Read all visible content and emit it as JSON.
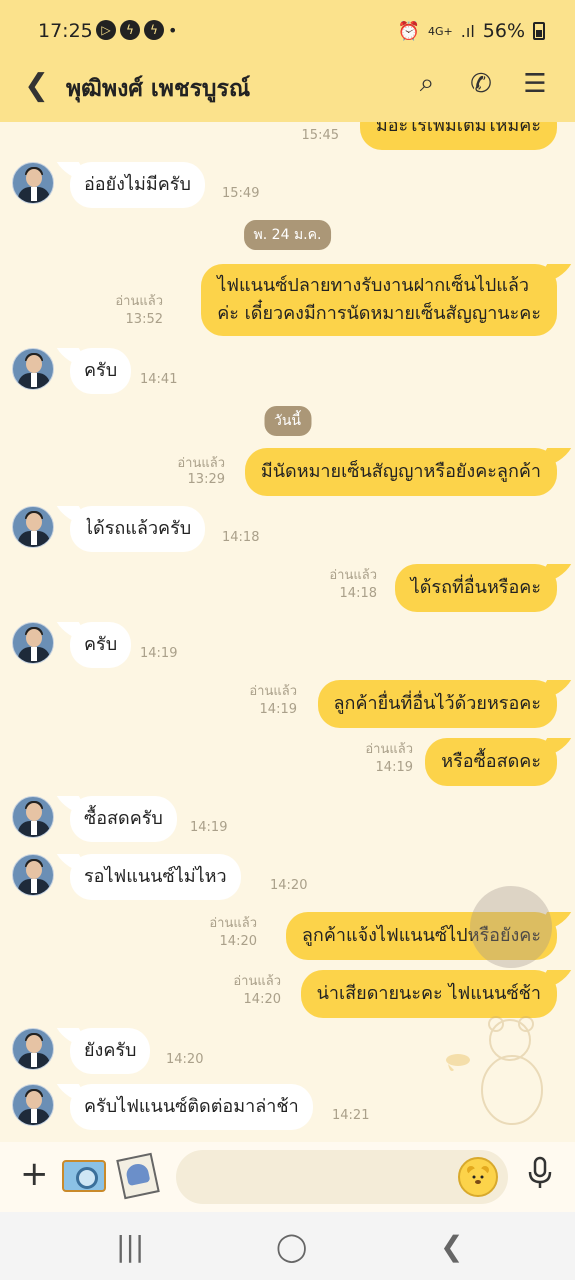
{
  "status_bar": {
    "time": "17:25",
    "network": "4G+",
    "signal": ".ıl",
    "battery": "56%",
    "icons": [
      "whatsapp-icon",
      "messenger-icon",
      "messenger-icon",
      "dot-icon",
      "alarm-icon",
      "battery-icon"
    ]
  },
  "header": {
    "title": "พุฒิพงศ์ เพชรบูรณ์",
    "back_glyph": "❮",
    "search_glyph": "⌕",
    "call_glyph": "✆",
    "menu_glyph": "☰"
  },
  "chat": {
    "top_partial": {
      "text": "มีอะไรเพิ่มเติมไหมคะ",
      "time": "15:45"
    },
    "messages": [
      {
        "dir": "in",
        "text": "อ่อยังไม่มีครับ",
        "time": "15:49"
      },
      {
        "dir": "date",
        "text": "พ. 24 ม.ค."
      },
      {
        "dir": "out",
        "lines": [
          "ไฟแนนซ์ปลายทางรับงานฝากเซ็นไปแล้ว",
          "ค่ะ เดี๋ยวคงมีการนัดหมายเซ็นสัญญานะคะ"
        ],
        "read": "อ่านแล้ว",
        "time": "13:52"
      },
      {
        "dir": "in",
        "text": "ครับ",
        "time": "14:41"
      },
      {
        "dir": "date",
        "text": "วันนี้"
      },
      {
        "dir": "out",
        "text": "มีนัดหมายเซ็นสัญญาหรือยังคะลูกค้า",
        "read": "อ่านแล้ว",
        "time": "13:29"
      },
      {
        "dir": "in",
        "text": "ได้รถแล้วครับ",
        "time": "14:18"
      },
      {
        "dir": "out",
        "text": "ได้รถที่อื่นหรือคะ",
        "read": "อ่านแล้ว",
        "time": "14:18"
      },
      {
        "dir": "in",
        "text": "ครับ",
        "time": "14:19"
      },
      {
        "dir": "out",
        "text": "ลูกค้ายื่นที่อื่นไว้ด้วยหรอคะ",
        "read": "อ่านแล้ว",
        "time": "14:19"
      },
      {
        "dir": "out",
        "text": "หรือซื้อสดคะ",
        "read": "อ่านแล้ว",
        "time": "14:19"
      },
      {
        "dir": "in",
        "text": "ซื้อสดครับ",
        "time": "14:19"
      },
      {
        "dir": "in",
        "text": "รอไฟแนนซ์ไม่ไหว",
        "time": "14:20"
      },
      {
        "dir": "out",
        "text": "ลูกค้าแจ้งไฟแนนซ์ไปหรือยังคะ",
        "read": "อ่านแล้ว",
        "time": "14:20"
      },
      {
        "dir": "out",
        "text": "น่าเสียดายนะคะ ไฟแนนซ์ช้า",
        "read": "อ่านแล้ว",
        "time": "14:20"
      },
      {
        "dir": "in",
        "text": "ยังครับ",
        "time": "14:20"
      },
      {
        "dir": "in",
        "text": "ครับไฟแนนซ์ติดต่อมาล่าช้า",
        "time": "14:21"
      }
    ]
  },
  "input_bar": {
    "plus_glyph": "+",
    "emoji_glyph": "ʕ•ᴥ•ʔ",
    "mic_glyph": "🎙",
    "placeholder": ""
  },
  "nav_bar": {
    "recents_glyph": "|||",
    "home_glyph": "◯",
    "back_glyph": "❮"
  }
}
